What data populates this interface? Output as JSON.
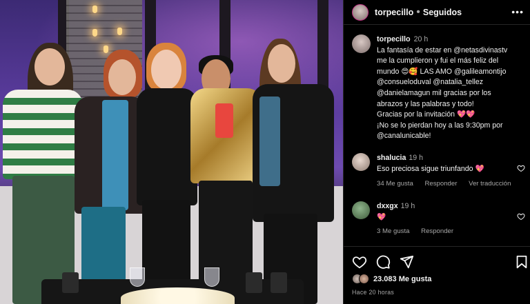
{
  "post": {
    "username": "torpecillo",
    "follow_label": "Seguidos",
    "caption_username": "torpecillo",
    "caption_time": "20 h",
    "caption_lines": [
      "La fantasía de estar en @netasdivinastv",
      "me la cumplieron y fui el más feliz del",
      "mundo 😍🥰 LAS AMO @galileamontijo",
      "@consueloduval @natalia_tellez",
      "@danielamagun mil gracias por los",
      "abrazos y las palabras y todo!",
      "Gracias por la invitación 💖💖",
      "¡No se lo pierdan hoy a las 9:30pm por",
      "@canalunicable!"
    ]
  },
  "comments": [
    {
      "user": "shalucia",
      "time": "19 h",
      "text": "Eso preciosa sigue triunfando 💖",
      "likes": "34 Me gusta",
      "reply": "Responder",
      "translate": "Ver traducción"
    },
    {
      "user": "dxxgx",
      "time": "19 h",
      "text": "💖",
      "likes": "3 Me gusta",
      "reply": "Responder"
    }
  ],
  "actions": {
    "likes_count": "23.083 Me gusta",
    "posted_ago": "Hace 20 horas"
  },
  "icons": [
    "more-options-icon",
    "heart-icon",
    "comment-icon",
    "share-icon",
    "bookmark-icon",
    "comment-like-icon"
  ],
  "colors": {
    "background": "#000000",
    "text": "#f5f5f5",
    "muted": "#a8a8a8",
    "heart": "#ff3b6b",
    "story_ring": "#c13584"
  }
}
